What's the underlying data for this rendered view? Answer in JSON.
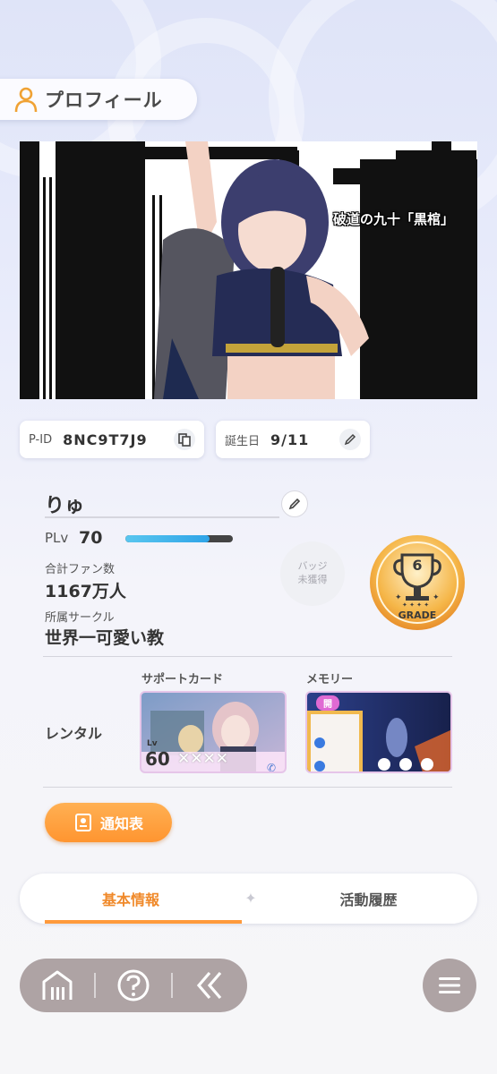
{
  "header": {
    "title": "プロフィール",
    "icon": "person-icon"
  },
  "banner": {
    "caption": "破道の九十「黒棺」"
  },
  "ids": {
    "pid_label": "P-ID",
    "pid_value": "8NC9T7J9",
    "birthday_label": "誕生日",
    "birthday_value": "9/11"
  },
  "profile": {
    "name": "りゅ",
    "plv_label": "PLv",
    "plv_value": "70",
    "plv_progress": 0.78,
    "fans_label": "合計ファン数",
    "fans_value": "1167万人",
    "circle_label": "所属サークル",
    "circle_value": "世界一可愛い教",
    "badge_line1": "バッジ",
    "badge_line2": "未獲得",
    "grade_number": "6",
    "grade_label": "GRADE"
  },
  "rental": {
    "label": "レンタル",
    "support_label": "サポートカード",
    "memory_label": "メモリー",
    "support_level_prefix": "Lv",
    "support_level": "60",
    "memory_tag": "開"
  },
  "report_button": {
    "label": "通知表"
  },
  "tabs": [
    {
      "label": "基本情報",
      "active": true
    },
    {
      "label": "活動履歴",
      "active": false
    }
  ],
  "colors": {
    "accent": "#ff9a3c",
    "nav": "#aea3a4",
    "bar": "#2fa4e7"
  }
}
